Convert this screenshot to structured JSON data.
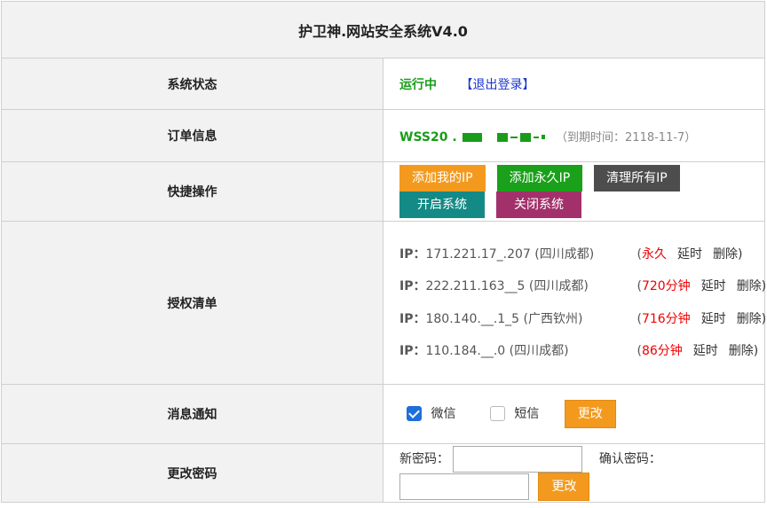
{
  "title": "护卫神.网站安全系统V4.0",
  "status": {
    "label": "系统状态",
    "state": "运行中",
    "logout": "【退出登录】"
  },
  "order": {
    "label": "订单信息",
    "number_prefix": "WSS20",
    "expiry": "（到期时间：2118-11-7）"
  },
  "quick": {
    "label": "快捷操作",
    "buttons": [
      {
        "label": "添加我的IP",
        "color": "#f39a1e"
      },
      {
        "label": "添加永久IP",
        "color": "#1aa01a"
      },
      {
        "label": "清理所有IP",
        "color": "#4d4d4d"
      },
      {
        "label": "开启系统",
        "color": "#148a86"
      },
      {
        "label": "关闭系统",
        "color": "#a2316b"
      }
    ]
  },
  "auth": {
    "label": "授权清单",
    "ip_label": "IP：",
    "rows": [
      {
        "ip": "171.221.17_.207 (四川成都)",
        "open": "(",
        "duration": "永久",
        "extend": "延时",
        "delete": "删除)"
      },
      {
        "ip": "222.211.163__5 (四川成都)",
        "open": "(",
        "duration": "720分钟",
        "extend": "延时",
        "delete": "删除)"
      },
      {
        "ip": "180.140.__.1_5 (广西钦州)",
        "open": "(",
        "duration": "716分钟",
        "extend": "延时",
        "delete": "删除)"
      },
      {
        "ip": "110.184.__.0 (四川成都)",
        "open": "(",
        "duration": "86分钟",
        "extend": "延时",
        "delete": "删除)"
      }
    ]
  },
  "notify": {
    "label": "消息通知",
    "wechat": "微信",
    "sms": "短信",
    "wechat_checked": true,
    "sms_checked": false,
    "change": "更改"
  },
  "password": {
    "label": "更改密码",
    "new_label": "新密码：",
    "confirm_label": "确认密码：",
    "change": "更改"
  }
}
